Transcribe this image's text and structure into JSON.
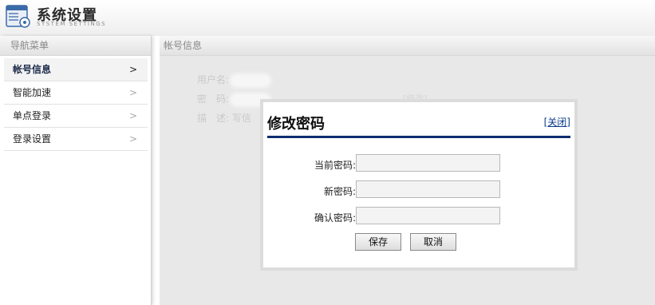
{
  "header": {
    "title": "系统设置",
    "subtitle": "SYSTEM SETTINGS",
    "logo_icon": "settings-window-icon"
  },
  "sidebar": {
    "title": "导航菜单",
    "items": [
      {
        "label": "帐号信息",
        "active": true,
        "chevron": ">"
      },
      {
        "label": "智能加速",
        "active": false,
        "chevron": ">"
      },
      {
        "label": "单点登录",
        "active": false,
        "chevron": ">"
      },
      {
        "label": "登录设置",
        "active": false,
        "chevron": ">"
      }
    ]
  },
  "main": {
    "title": "帐号信息",
    "fields": {
      "username_label": "用户名:",
      "password_label": "密　码:",
      "description_label": "描　述:",
      "description_value": "写信",
      "modify_link": "[修改]"
    }
  },
  "modal": {
    "title": "修改密码",
    "close_label": "[关闭]",
    "fields": [
      {
        "label": "当前密码:",
        "value": ""
      },
      {
        "label": "新密码:",
        "value": ""
      },
      {
        "label": "确认密码:",
        "value": ""
      }
    ],
    "save_label": "保存",
    "cancel_label": "取消"
  },
  "colors": {
    "accent": "#0d2d6e",
    "link": "#0a3a8a"
  }
}
